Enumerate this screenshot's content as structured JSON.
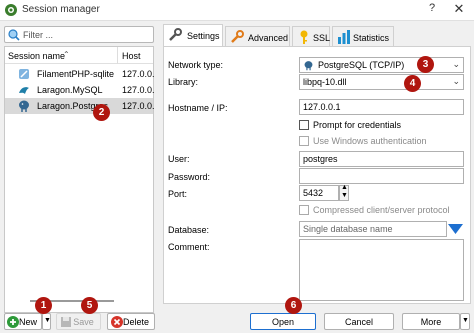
{
  "window": {
    "title": "Session manager",
    "help": "?",
    "close": "✕"
  },
  "sidebar": {
    "filter_placeholder": "Filter ...",
    "col_name": "Session name",
    "col_sort": "⌃",
    "col_host": "Host",
    "sessions": [
      {
        "name": "FilamentPHP-sqlite",
        "host": "127.0.0."
      },
      {
        "name": "Laragon.MySQL",
        "host": "127.0.0."
      },
      {
        "name": "Laragon.Postgres",
        "host": "127.0.0."
      }
    ]
  },
  "tabs": [
    {
      "label": "Settings",
      "icon": "wrench-icon"
    },
    {
      "label": "Advanced",
      "icon": "wrench-orange-icon"
    },
    {
      "label": "SSL",
      "icon": "key-icon"
    },
    {
      "label": "Statistics",
      "icon": "bar-chart-icon"
    }
  ],
  "settings": {
    "network_type_label": "Network type:",
    "network_type_value": "PostgreSQL (TCP/IP)",
    "library_label": "Library:",
    "library_value": "libpq-10.dll",
    "hostname_label": "Hostname / IP:",
    "hostname_value": "127.0.0.1",
    "prompt_credentials": "Prompt for credentials",
    "use_windows_auth": "Use Windows authentication",
    "user_label": "User:",
    "user_value": "postgres",
    "password_label": "Password:",
    "password_value": "",
    "port_label": "Port:",
    "port_value": "5432",
    "compressed_protocol": "Compressed client/server protocol",
    "database_label": "Database:",
    "database_placeholder": "Single database name",
    "comment_label": "Comment:"
  },
  "buttons": {
    "new": "New",
    "save": "Save",
    "delete": "Delete",
    "open": "Open",
    "cancel": "Cancel",
    "more": "More"
  },
  "badges": [
    "1",
    "2",
    "3",
    "4",
    "5",
    "6"
  ],
  "colors": {
    "badge": "#b0160f",
    "selection": "#d9d9d9",
    "accent_blue": "#1d6fd0"
  }
}
